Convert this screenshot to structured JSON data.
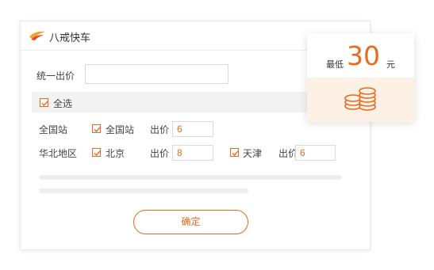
{
  "app": {
    "title": "八戒快车"
  },
  "unified_bid": {
    "label": "统一出价",
    "value": ""
  },
  "select_all": {
    "label": "全选",
    "checked": true
  },
  "rows": [
    {
      "group": "全国站",
      "items": [
        {
          "label": "全国站",
          "checked": true,
          "bid_label": "出价",
          "bid_value": "6"
        }
      ]
    },
    {
      "group": "华北地区",
      "items": [
        {
          "label": "北京",
          "checked": true,
          "bid_label": "出价",
          "bid_value": "8"
        },
        {
          "label": "天津",
          "checked": true,
          "bid_label": "出价",
          "bid_value": "6"
        }
      ]
    }
  ],
  "confirm": {
    "label": "确定"
  },
  "price_card": {
    "min_label": "最低",
    "value": "30",
    "unit": "元",
    "icon": "coins-icon"
  },
  "colors": {
    "accent": "#e86a1d",
    "card_bottom": "#fdf1e6"
  }
}
